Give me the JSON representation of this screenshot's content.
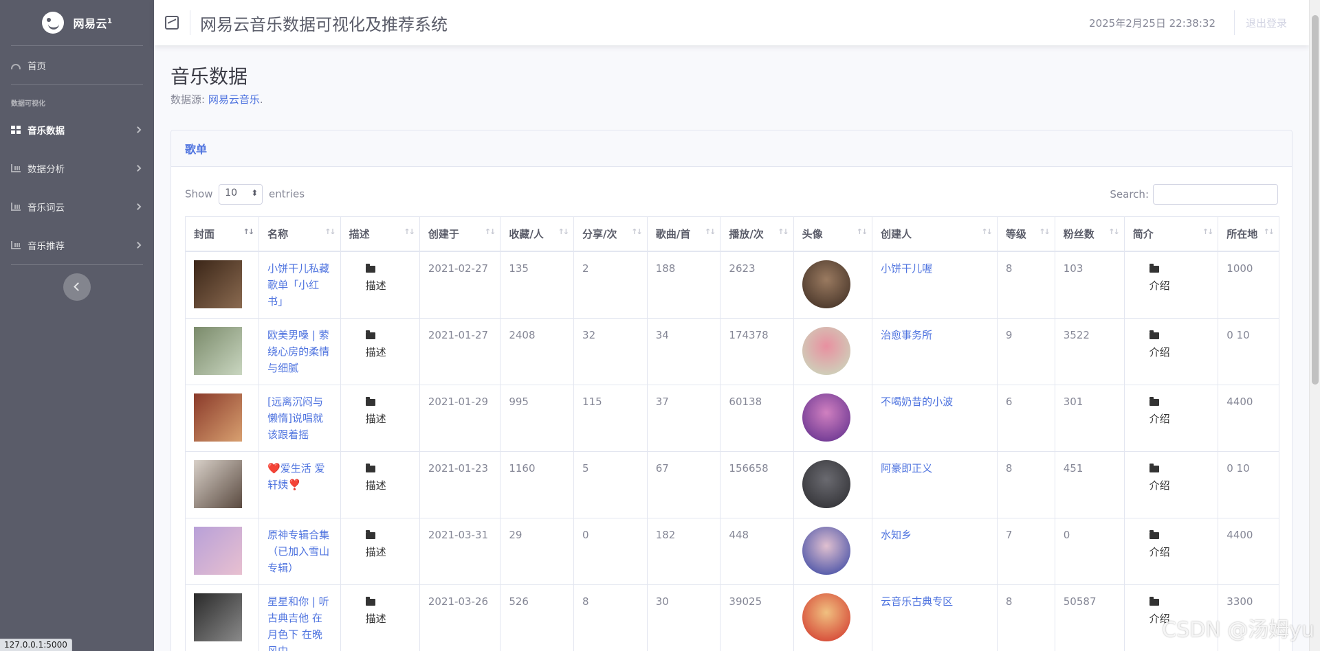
{
  "sidebar": {
    "brand": "网易云",
    "brand_sup": "1",
    "home": "首页",
    "heading": "数据可视化",
    "items": [
      "音乐数据",
      "数据分析",
      "音乐词云",
      "音乐推荐"
    ]
  },
  "topbar": {
    "title": "网易云音乐数据可视化及推荐系统",
    "datetime": "2025年2月25日 22:38:32",
    "logout": "退出登录"
  },
  "page": {
    "title": "音乐数据",
    "source_prefix": "数据源: ",
    "source_link": "网易云音乐",
    "source_suffix": "."
  },
  "card": {
    "header": "歌单",
    "show_label": "Show",
    "entries_value": "10",
    "entries_label": "entries",
    "search_label": "Search:"
  },
  "table": {
    "columns": [
      "封面",
      "名称",
      "描述",
      "创建于",
      "收藏/人",
      "分享/次",
      "歌曲/首",
      "播放/次",
      "头像",
      "创建人",
      "等级",
      "粉丝数",
      "简介",
      "所在地"
    ],
    "describe_label": "描述",
    "intro_label": "介绍",
    "rows": [
      {
        "name": "小饼干儿私藏歌单「小红书」",
        "created": "2021-02-27",
        "favorites": "135",
        "shares": "2",
        "songs": "188",
        "plays": "2623",
        "creator": "小饼干儿喔",
        "level": "8",
        "fans": "103",
        "location": "1000"
      },
      {
        "name": "欧美男嗓 | 萦绕心房的柔情与细腻",
        "created": "2021-01-27",
        "favorites": "2408",
        "shares": "32",
        "songs": "34",
        "plays": "174378",
        "creator": "治愈事务所",
        "level": "9",
        "fans": "3522",
        "location": "0 10"
      },
      {
        "name": "[远离沉闷与懒惰]说唱就该跟着摇",
        "created": "2021-01-29",
        "favorites": "995",
        "shares": "115",
        "songs": "37",
        "plays": "60138",
        "creator": "不喝奶昔的小波",
        "level": "6",
        "fans": "301",
        "location": "4400"
      },
      {
        "name": "❤️爱生活 爱轩姨❣️",
        "created": "2021-01-23",
        "favorites": "1160",
        "shares": "5",
        "songs": "67",
        "plays": "156658",
        "creator": "阿豪即正义",
        "level": "8",
        "fans": "451",
        "location": "0 10"
      },
      {
        "name": "原神专辑合集（已加入雪山专辑）",
        "created": "2021-03-31",
        "favorites": "29",
        "shares": "0",
        "songs": "182",
        "plays": "448",
        "creator": "水知乡",
        "level": "7",
        "fans": "0",
        "location": "4400"
      },
      {
        "name": "星星和你 | 听古典吉他 在月色下 在晚风中",
        "created": "2021-03-26",
        "favorites": "526",
        "shares": "8",
        "songs": "30",
        "plays": "39025",
        "creator": "云音乐古典专区",
        "level": "8",
        "fans": "50587",
        "location": "3300"
      }
    ]
  },
  "statusbar": "127.0.0.1:5000",
  "watermark": "CSDN @汤姆yu",
  "colors": {
    "sidebar": "#5a5c69",
    "accent": "#4e73df",
    "background": "#f8f9fc"
  }
}
